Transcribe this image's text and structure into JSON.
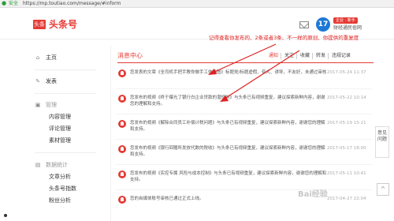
{
  "browser": {
    "security_label": "安全",
    "url": "https://mp.toutiao.com/message/#inform"
  },
  "header": {
    "logo_box": "头条",
    "logo_text": "头条号",
    "avatar_letter": "17",
    "badge": "企业 · 新手",
    "account": "财经通民俗网"
  },
  "annotation_top": "记得查看你发布的、2条或者3条、不一样的原创、你提供的重复度",
  "sidebar": {
    "home": "主页",
    "publish": "发表",
    "manage": "管理",
    "manage_items": [
      "内容管理",
      "评论管理",
      "素材管理"
    ],
    "stats": "数据统计",
    "stats_items": [
      "文章分析",
      "头条号指数",
      "粉丝分析"
    ]
  },
  "main": {
    "title": "消息中心",
    "tabs": [
      "通知",
      "关注",
      "收藏",
      "转发",
      "违规记录"
    ],
    "messages": [
      {
        "text": "您发表的文章《全司机手把手教你做手工体操图》标题党/标题虚假、夸大、诱导，不友好，未通过审核",
        "time": "2017-05-24 11:37"
      },
      {
        "text": "您发布的视频《终于曝光了银行白企业贷款的潜规则》与头条已有视频重复，建议探索新鲜内容，谢谢您的理解和支持。",
        "time": "2017-05-22 10:14"
      },
      {
        "text": "您发布的视频《解除合同员工补偿计税问题》与头条已有视频重复，建议探索新鲜内容，谢谢您的理解和支持。",
        "time": "2017-05-19 15:21"
      },
      {
        "text": "您发布的视频《银行回赠所发放代数的税收》与头条已有视频重复，建议探索新鲜内容，谢谢您的理解和支持。",
        "time": "2017-05-17 18:00"
      },
      {
        "text": "您发布的视频《实控专属 风险与成本控制》与头条已有视频重复，建议探索新鲜内容，谢谢您的理解和支持。",
        "time": "2017-05-11 10:41"
      },
      {
        "text": "您的自媒体账号审核已通过正式上线。",
        "time": "2017-04-27 22:04"
      }
    ]
  },
  "float_panel": "意见问题",
  "back_top": "^",
  "watermark": "Bai经验"
}
